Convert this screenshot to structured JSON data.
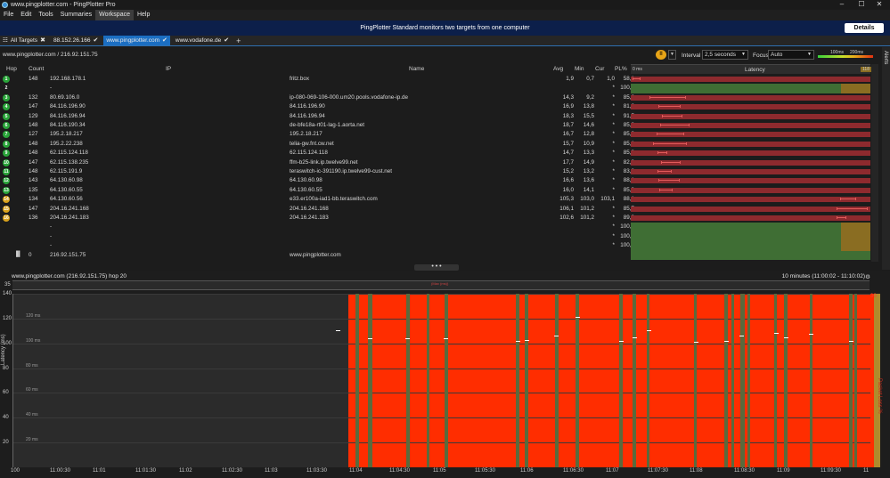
{
  "window": {
    "title": "www.pingplotter.com - PingPlotter Pro",
    "controls": [
      "–",
      "☐",
      "✕"
    ]
  },
  "menu": [
    "File",
    "Edit",
    "Tools",
    "Summaries",
    "Workspace",
    "Help"
  ],
  "banner": {
    "message": "PingPlotter Standard monitors two targets from one computer",
    "details": "Details"
  },
  "tabs": [
    {
      "label": "All Targets",
      "mark": "✖"
    },
    {
      "label": "88.152.26.166",
      "mark": "✔"
    },
    {
      "label": "www.pingplotter.com",
      "mark": "✔"
    },
    {
      "label": "www.vodafone.de",
      "mark": "✔"
    }
  ],
  "toolbar": {
    "host": "www.pingplotter.com / 216.92.151.75",
    "interval_label": "Interval",
    "interval_value": "2,5 seconds",
    "focus_label": "Focus",
    "focus_value": "Auto",
    "scale_a": "100ms",
    "scale_b": "200ms",
    "pause": "II"
  },
  "alerts": "Alerts",
  "headers": {
    "hop": "Hop",
    "count": "Count",
    "ip": "IP",
    "name": "Name",
    "avg": "Avg",
    "min": "Min",
    "cur": "Cur",
    "pl": "PL%",
    "lat0": "0 ms",
    "latency": "Latency",
    "latmax": "118"
  },
  "hops": [
    {
      "hop": "1",
      "count": "148",
      "ip": "192.168.178.1",
      "name": "fritz.box",
      "avg": "1,9",
      "min": "0,7",
      "cur": "1,0",
      "pl": "58,1",
      "color": "#2aa53a"
    },
    {
      "hop": "2",
      "count": "",
      "ip": "-",
      "name": "",
      "avg": "",
      "min": "",
      "cur": "*",
      "pl": "100,0",
      "color": ""
    },
    {
      "hop": "3",
      "count": "132",
      "ip": "80.69.106.0",
      "name": "ip-080-069-106-000.um20.pools.vodafone-ip.de",
      "avg": "14,3",
      "min": "9,2",
      "cur": "*",
      "pl": "85,6",
      "color": "#2aa53a"
    },
    {
      "hop": "4",
      "count": "147",
      "ip": "84.116.196.90",
      "name": "84.116.196.90",
      "avg": "16,9",
      "min": "13,8",
      "cur": "*",
      "pl": "81,6",
      "color": "#2aa53a"
    },
    {
      "hop": "5",
      "count": "129",
      "ip": "84.116.196.94",
      "name": "84.116.196.94",
      "avg": "18,3",
      "min": "15,5",
      "cur": "*",
      "pl": "91,5",
      "color": "#2aa53a"
    },
    {
      "hop": "6",
      "count": "148",
      "ip": "84.116.190.34",
      "name": "de-bfe18a-rt01-lag-1.aorta.net",
      "avg": "18,7",
      "min": "14,6",
      "cur": "*",
      "pl": "85,8",
      "color": "#2aa53a"
    },
    {
      "hop": "7",
      "count": "127",
      "ip": "195.2.18.217",
      "name": "195.2.18.217",
      "avg": "16,7",
      "min": "12,8",
      "cur": "*",
      "pl": "85,0",
      "color": "#2aa53a"
    },
    {
      "hop": "8",
      "count": "148",
      "ip": "195.2.22.238",
      "name": "telia-gw.fnt.cw.net",
      "avg": "15,7",
      "min": "10,9",
      "cur": "*",
      "pl": "85,1",
      "color": "#2aa53a"
    },
    {
      "hop": "9",
      "count": "148",
      "ip": "62.115.124.118",
      "name": "62.115.124.118",
      "avg": "14,7",
      "min": "13,3",
      "cur": "*",
      "pl": "85,8",
      "color": "#2aa53a"
    },
    {
      "hop": "10",
      "count": "147",
      "ip": "62.115.138.235",
      "name": "ffm-b25-link.ip.twelve99.net",
      "avg": "17,7",
      "min": "14,9",
      "cur": "*",
      "pl": "82,3",
      "color": "#2aa53a"
    },
    {
      "hop": "11",
      "count": "148",
      "ip": "62.115.191.9",
      "name": "teraswitch-ic-391190.ip.twelve99-cust.net",
      "avg": "15,2",
      "min": "13,2",
      "cur": "*",
      "pl": "83,8",
      "color": "#2aa53a"
    },
    {
      "hop": "12",
      "count": "143",
      "ip": "64.130.60.98",
      "name": "64.130.60.98",
      "avg": "16,6",
      "min": "13,6",
      "cur": "*",
      "pl": "88,1",
      "color": "#2aa53a"
    },
    {
      "hop": "13",
      "count": "135",
      "ip": "64.130.60.55",
      "name": "64.130.60.55",
      "avg": "16,0",
      "min": "14,1",
      "cur": "*",
      "pl": "85,9",
      "color": "#2aa53a"
    },
    {
      "hop": "14",
      "count": "134",
      "ip": "64.130.60.56",
      "name": "e33.er100a-iad1-bb.teraswitch.com",
      "avg": "105,3",
      "min": "103,0",
      "cur": "103,1",
      "pl": "88,1",
      "color": "#d9a21b"
    },
    {
      "hop": "15",
      "count": "147",
      "ip": "204.16.241.168",
      "name": "204.16.241.168",
      "avg": "106,1",
      "min": "101,2",
      "cur": "*",
      "pl": "85,7",
      "color": "#d9a21b"
    },
    {
      "hop": "16",
      "count": "136",
      "ip": "204.16.241.183",
      "name": "204.16.241.183",
      "avg": "102,6",
      "min": "101,2",
      "cur": "*",
      "pl": "89,0",
      "color": "#d9a21b"
    },
    {
      "hop": "",
      "count": "",
      "ip": "-",
      "name": "",
      "avg": "",
      "min": "",
      "cur": "*",
      "pl": "100,0",
      "color": ""
    },
    {
      "hop": "",
      "count": "",
      "ip": "-",
      "name": "",
      "avg": "",
      "min": "",
      "cur": "*",
      "pl": "100,0",
      "color": ""
    },
    {
      "hop": "",
      "count": "",
      "ip": "-",
      "name": "",
      "avg": "",
      "min": "",
      "cur": "*",
      "pl": "100,0",
      "color": ""
    },
    {
      "hop": "",
      "count": "0",
      "ip": "216.92.151.75",
      "name": "www.pingplotter.com",
      "avg": "",
      "min": "",
      "cur": "",
      "pl": "",
      "color": ""
    }
  ],
  "timeline": {
    "title": "www.pingplotter.com (216.92.151.75) hop 20",
    "range": "10 minutes (11:00:02 - 11:10:02)",
    "mini_label": "35",
    "mini_max": "(Max (ms))",
    "y_title": "Latency (ms)",
    "y_ticks": [
      "140",
      "120 ms",
      "100 ms",
      "80 ms",
      "60 ms",
      "40 ms",
      "20 ms"
    ],
    "y_left": [
      "140",
      "120",
      "100",
      "80",
      "60",
      "40",
      "20"
    ],
    "pl_right": "30",
    "pl_title": "Packet Loss %",
    "x_ticks": [
      "100",
      "11:00:30",
      "11:01",
      "11:01:30",
      "11:02",
      "11:02:30",
      "11:03",
      "11:03:30",
      "11:04",
      "11:04:30",
      "11:05",
      "11:05:30",
      "11:06",
      "11:06:30",
      "11:07",
      "11:07:30",
      "11:08",
      "11:08:30",
      "11:09",
      "11:09:30",
      "11"
    ]
  },
  "colors": {
    "loss": "#ff2d00",
    "ok": "#3f6e34",
    "warn": "#8a6d22",
    "accent": "#1b6ec2",
    "banner": "#0c1f4a"
  }
}
